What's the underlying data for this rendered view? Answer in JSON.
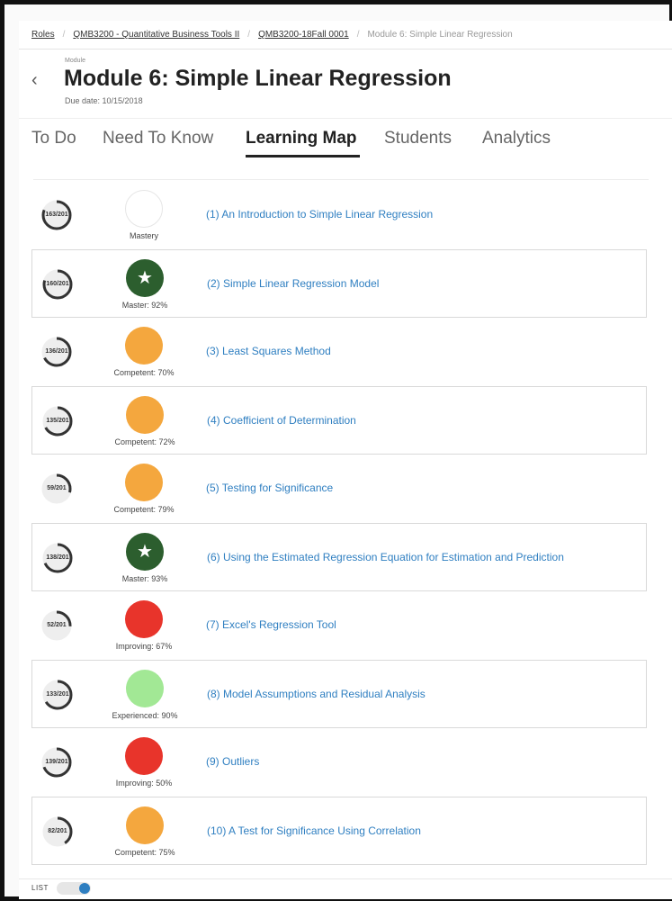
{
  "breadcrumb": {
    "items": [
      "Roles",
      "QMB3200 - Quantitative Business Tools II",
      "QMB3200-18Fall 0001"
    ],
    "current": "Module 6: Simple Linear Regression",
    "separator": "/"
  },
  "header": {
    "back_icon": "chevron-left-icon",
    "back_glyph": "‹",
    "eyebrow": "Module",
    "title": "Module 6: Simple Linear Regression",
    "due": "Due date: 10/15/2018"
  },
  "tabs": [
    {
      "label": "To Do",
      "active": false
    },
    {
      "label": "Need To Know",
      "active": false
    },
    {
      "label": "Learning Map",
      "active": true
    },
    {
      "label": "Students",
      "active": false
    },
    {
      "label": "Analytics",
      "active": false
    }
  ],
  "colors": {
    "master": "#2c5e2e",
    "competent": "#f4a73e",
    "improving": "#e8342b",
    "experienced": "#a2e895",
    "link": "#2f7fc1"
  },
  "topics": [
    {
      "progress": "163/201",
      "done": 163,
      "total": 201,
      "badge": "empty",
      "status": "Mastery",
      "title": "(1) An Introduction to Simple Linear Regression"
    },
    {
      "progress": "160/201",
      "done": 160,
      "total": 201,
      "badge": "master",
      "status": "Master: 92%",
      "title": "(2) Simple Linear Regression Model"
    },
    {
      "progress": "136/201",
      "done": 136,
      "total": 201,
      "badge": "competent",
      "status": "Competent: 70%",
      "title": "(3) Least Squares Method"
    },
    {
      "progress": "135/201",
      "done": 135,
      "total": 201,
      "badge": "competent",
      "status": "Competent: 72%",
      "title": "(4) Coefficient of Determination"
    },
    {
      "progress": "59/201",
      "done": 59,
      "total": 201,
      "badge": "competent",
      "status": "Competent: 79%",
      "title": "(5) Testing for Significance"
    },
    {
      "progress": "138/201",
      "done": 138,
      "total": 201,
      "badge": "master",
      "status": "Master: 93%",
      "title": "(6) Using the Estimated Regression Equation for Estimation and Prediction"
    },
    {
      "progress": "52/201",
      "done": 52,
      "total": 201,
      "badge": "improving",
      "status": "Improving: 67%",
      "title": "(7) Excel's Regression Tool"
    },
    {
      "progress": "133/201",
      "done": 133,
      "total": 201,
      "badge": "experienced",
      "status": "Experienced: 90%",
      "title": "(8) Model Assumptions and Residual Analysis"
    },
    {
      "progress": "139/201",
      "done": 139,
      "total": 201,
      "badge": "improving",
      "status": "Improving: 50%",
      "title": "(9) Outliers"
    },
    {
      "progress": "82/201",
      "done": 82,
      "total": 201,
      "badge": "competent",
      "status": "Competent: 75%",
      "title": "(10) A Test for Significance Using Correlation"
    }
  ],
  "star_glyph": "★",
  "footer": {
    "label": "LIST",
    "toggle_on": true
  }
}
